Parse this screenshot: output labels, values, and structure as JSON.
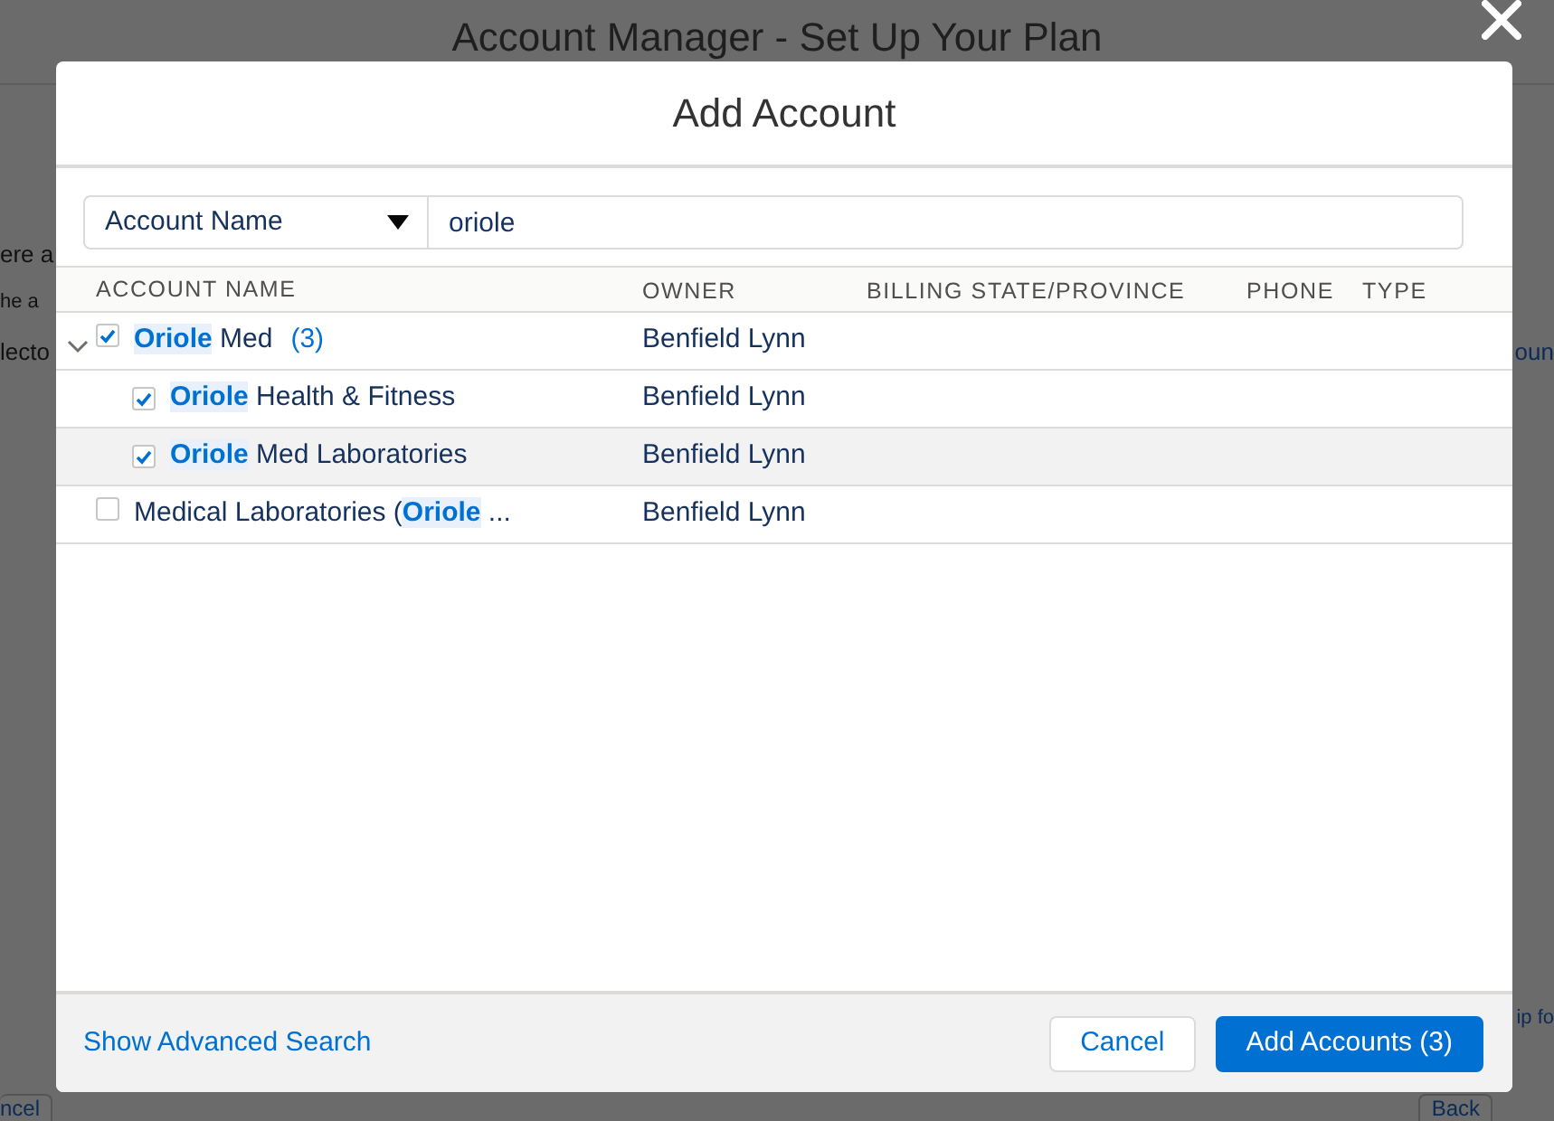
{
  "background": {
    "title": "Account Manager - Set Up Your Plan",
    "fragments": [
      {
        "left": "ere a"
      },
      {
        "left": "he a"
      },
      {
        "left": "lecto",
        "right": "oun"
      }
    ],
    "footer_note": "ip fo",
    "buttons": [
      "ncel",
      "Back"
    ]
  },
  "modal": {
    "title": "Add Account",
    "search": {
      "field": "Account Name",
      "value": "oriole"
    },
    "columns": [
      "ACCOUNT NAME",
      "OWNER",
      "BILLING STATE/PROVINCE",
      "PHONE",
      "TYPE"
    ],
    "rows": [
      {
        "match": "Oriole",
        "after": " Med",
        "count": "(3)",
        "owner": "Benfield Lynn",
        "checked": true,
        "highlighted": false,
        "expanded": true,
        "children": [
          {
            "match": "Oriole",
            "after": " Health & Fitness",
            "owner": "Benfield Lynn",
            "checked": true,
            "highlighted": false
          },
          {
            "match": "Oriole",
            "after": " Med Laboratories",
            "owner": "Benfield Lynn",
            "checked": true,
            "highlighted": true
          }
        ]
      },
      {
        "before": "Medical Laboratories (",
        "match": "Oriole",
        "after": " ...",
        "owner": "Benfield Lynn",
        "checked": false,
        "highlighted": false
      }
    ],
    "advanced_link": "Show Advanced Search",
    "buttons": [
      {
        "label": "Cancel",
        "kind": "neutral"
      },
      {
        "label": "Add Accounts (3)",
        "kind": "brand"
      }
    ]
  }
}
